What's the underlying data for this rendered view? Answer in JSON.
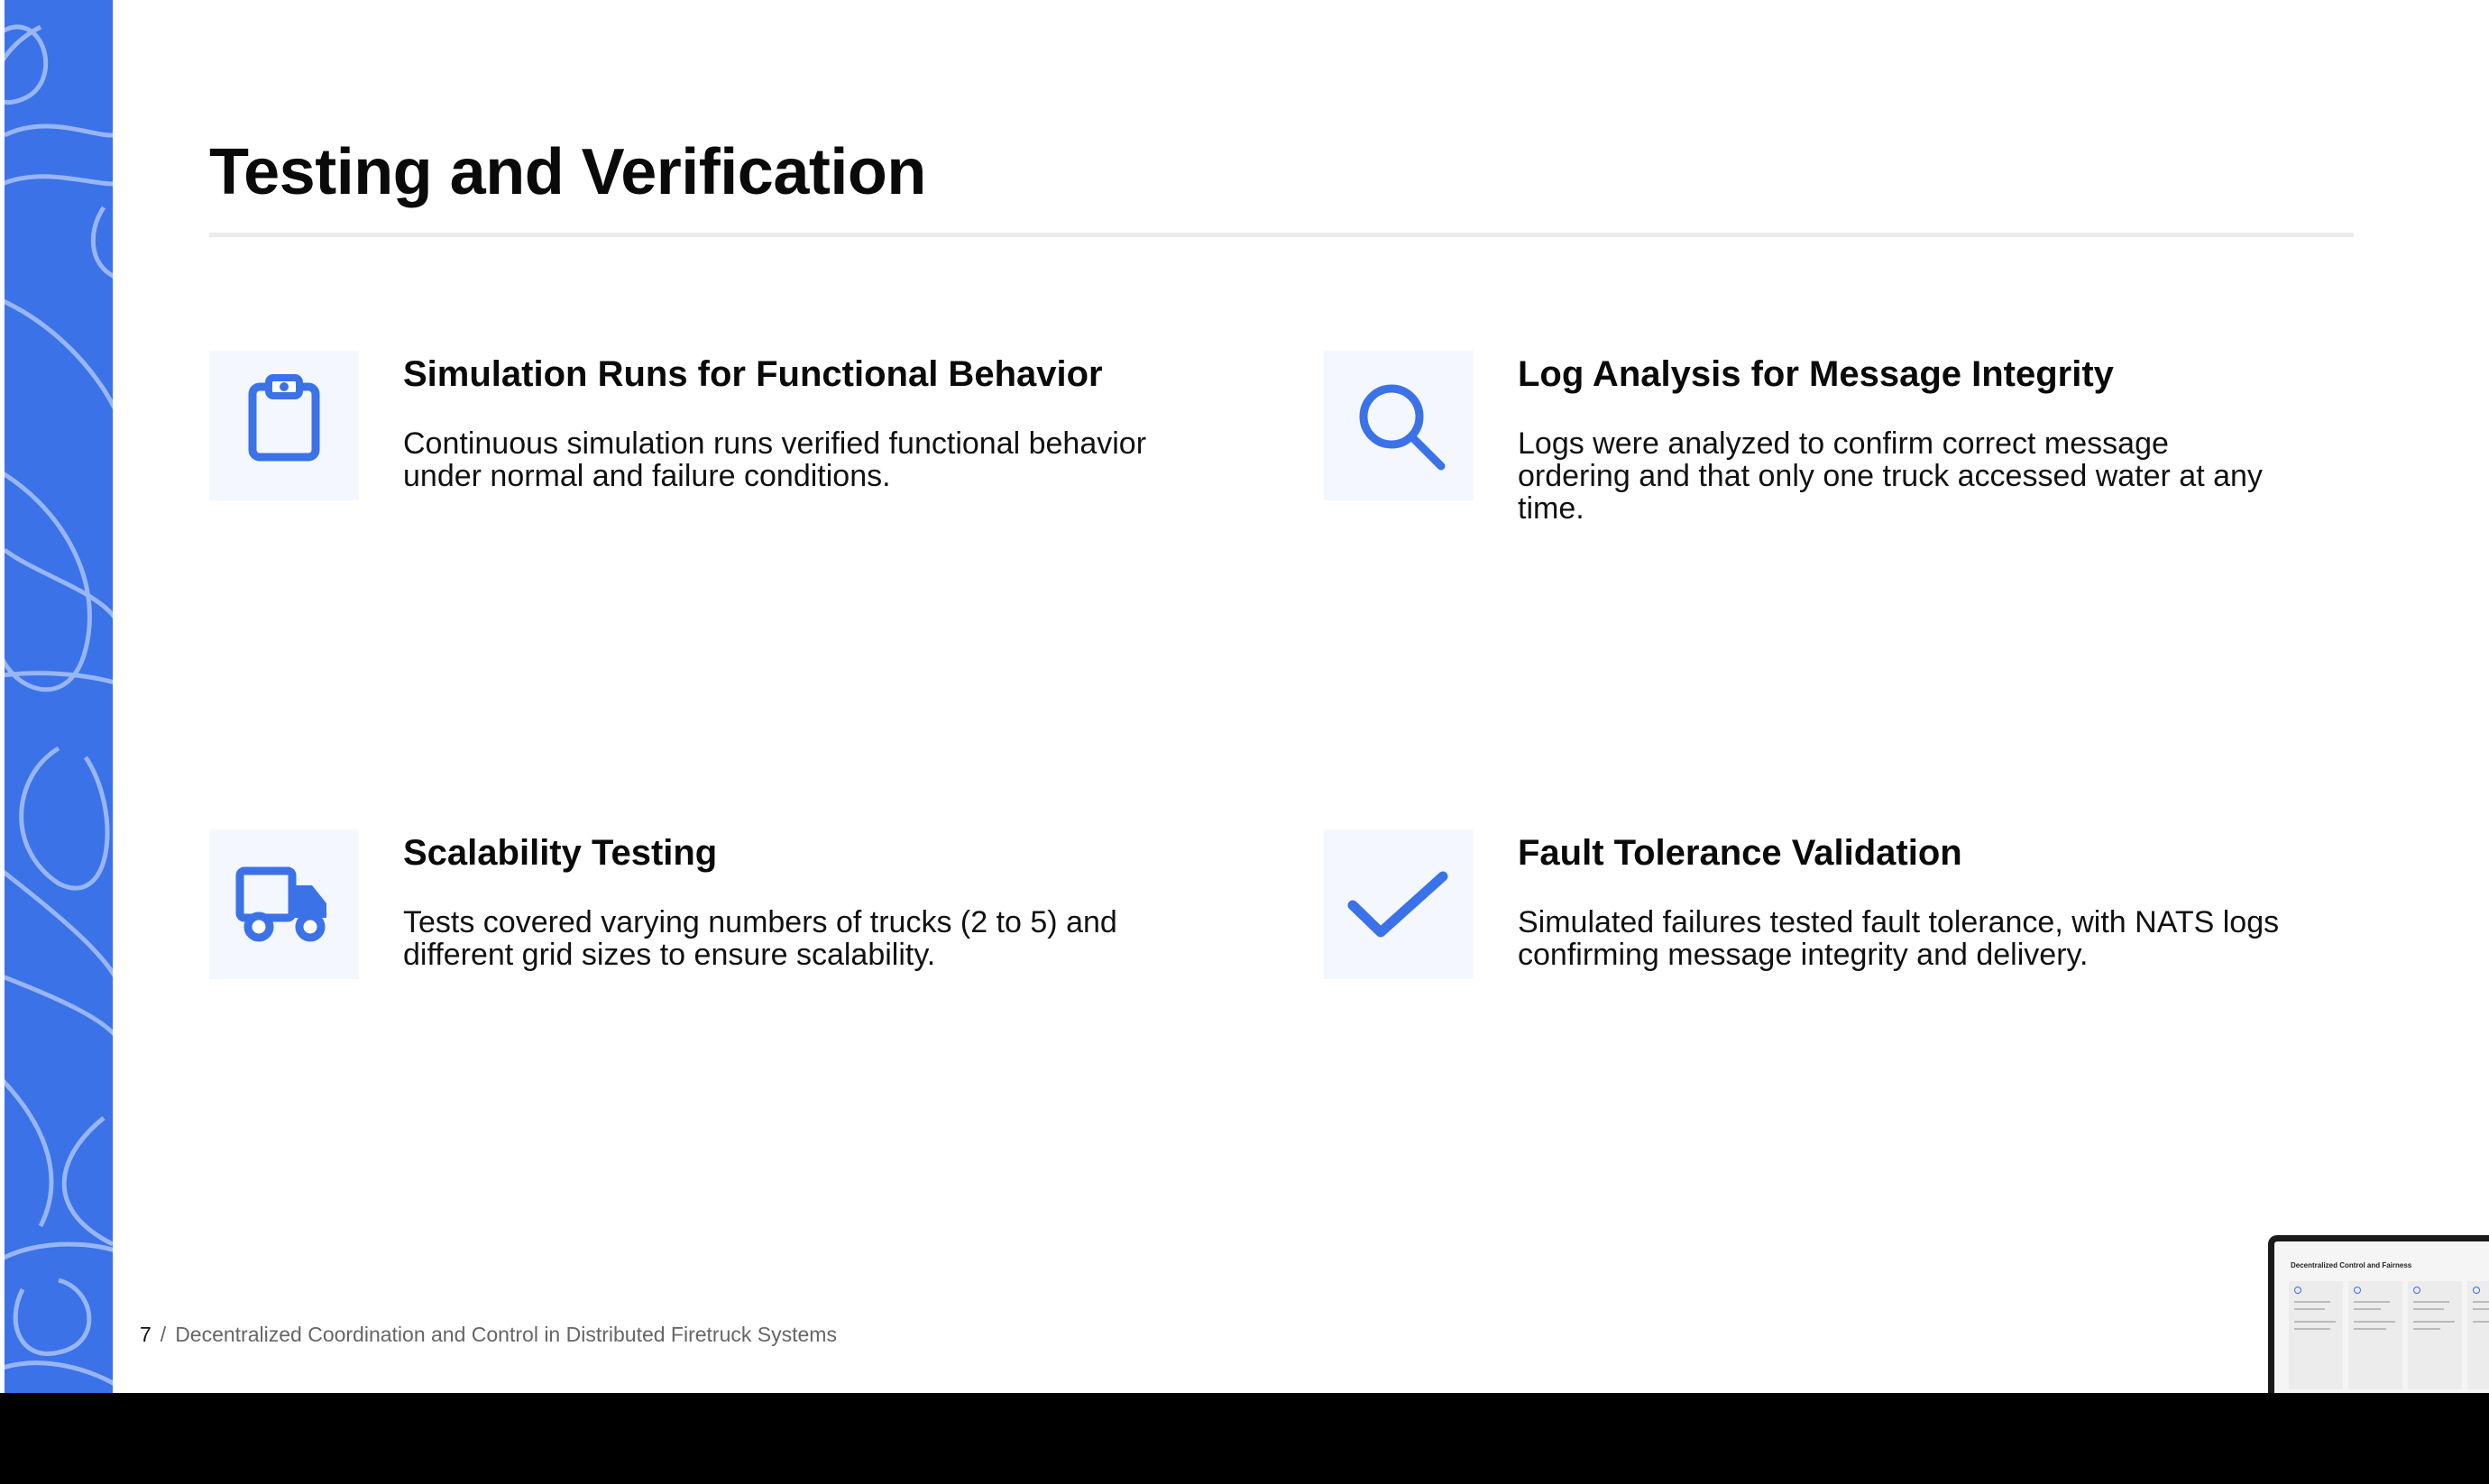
{
  "slide": {
    "title": "Testing and Verification",
    "accent_color": "#3b72e8",
    "cards": [
      {
        "icon": "clipboard-icon",
        "heading": "Simulation Runs for Functional Behavior",
        "text": "Continuous simulation runs verified functional behavior under normal and failure conditions."
      },
      {
        "icon": "search-icon",
        "heading": "Log Analysis for Message Integrity",
        "text": "Logs were analyzed to confirm correct message ordering and that only one truck accessed water at any time."
      },
      {
        "icon": "truck-icon",
        "heading": "Scalability Testing",
        "text": "Tests covered varying numbers of trucks (2 to 5) and different grid sizes to ensure scalability."
      },
      {
        "icon": "checkmark-icon",
        "heading": "Fault Tolerance Validation",
        "text": "Simulated failures tested fault tolerance, with NATS logs confirming message integrity and delivery."
      }
    ]
  },
  "footer": {
    "page_number": "7",
    "separator": "/",
    "deck_title": "Decentralized Coordination and Control in Distributed Firetruck Systems"
  },
  "next_slide_thumbnail": {
    "title": "Decentralized Control and Fairness"
  }
}
